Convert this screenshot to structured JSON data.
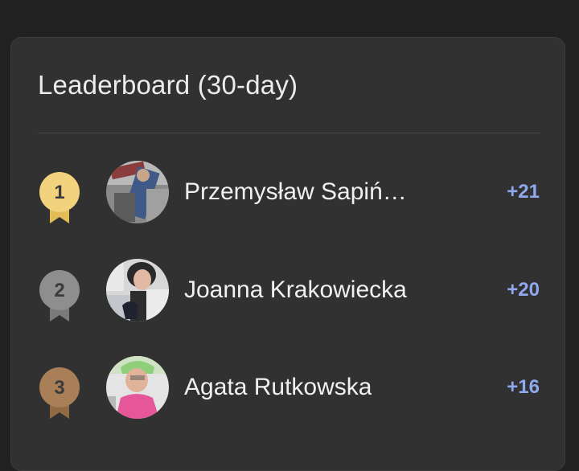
{
  "leaderboard": {
    "title": "Leaderboard (30-day)",
    "entries": [
      {
        "rank": "1",
        "name": "Przemysław Sapiń…",
        "score": "+21",
        "medal_color": "#f2d27c",
        "medal_ribbon": "#e3bb57"
      },
      {
        "rank": "2",
        "name": "Joanna Krakowiecka",
        "score": "+20",
        "medal_color": "#8e8e8e",
        "medal_ribbon": "#7a7a7a"
      },
      {
        "rank": "3",
        "name": "Agata Rutkowska",
        "score": "+16",
        "medal_color": "#a87f57",
        "medal_ribbon": "#916a45"
      }
    ]
  }
}
